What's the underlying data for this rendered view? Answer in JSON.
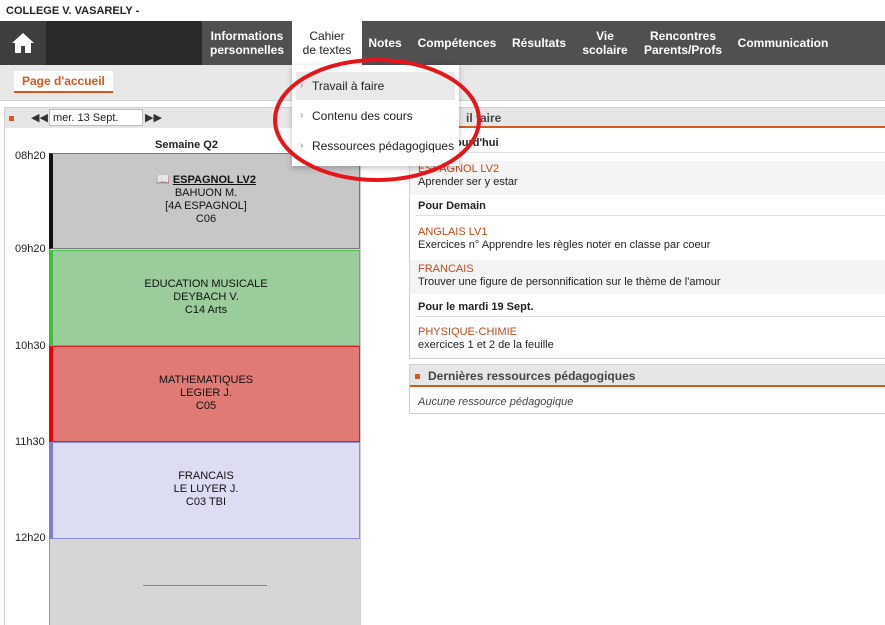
{
  "header": {
    "school_name": "COLLEGE V. VASARELY -"
  },
  "nav": {
    "home_icon": "home-icon",
    "items": [
      {
        "id": "info",
        "line1": "Informations",
        "line2": "personnelles"
      },
      {
        "id": "cahier",
        "line1": "Cahier",
        "line2": "de textes"
      },
      {
        "id": "notes",
        "line1": "Notes",
        "line2": ""
      },
      {
        "id": "competences",
        "line1": "Compétences",
        "line2": ""
      },
      {
        "id": "resultats",
        "line1": "Résultats",
        "line2": ""
      },
      {
        "id": "vie",
        "line1": "Vie",
        "line2": "scolaire"
      },
      {
        "id": "rencontres",
        "line1": "Rencontres",
        "line2": "Parents/Profs"
      },
      {
        "id": "communication",
        "line1": "Communication",
        "line2": ""
      }
    ]
  },
  "subbar": {
    "home_tab": "Page d'accueil"
  },
  "dropdown": {
    "items": [
      {
        "label": "Travail à faire"
      },
      {
        "label": "Contenu des cours"
      },
      {
        "label": "Ressources pédagogiques"
      }
    ]
  },
  "timetable": {
    "date_value": "mer. 13 Sept.",
    "week": "Semaine Q2",
    "times": [
      "08h20",
      "09h20",
      "10h30",
      "11h30",
      "12h20"
    ],
    "courses": [
      {
        "subject": "ESPAGNOL LV2",
        "teacher": "BAHUON M.",
        "group": "[4A ESPAGNOL]",
        "room": "C06",
        "color": "#c7c7c7"
      },
      {
        "subject": "EDUCATION MUSICALE",
        "teacher": "DEYBACH V.",
        "group": "",
        "room": "C14 Arts",
        "color": "#9bcc9b"
      },
      {
        "subject": "MATHEMATIQUES",
        "teacher": "LEGIER J.",
        "group": "",
        "room": "C05",
        "color": "#e07a75"
      },
      {
        "subject": "FRANCAIS",
        "teacher": "LE LUYER J.",
        "group": "",
        "room": "C03 TBI",
        "color": "#dcdcf3"
      }
    ]
  },
  "travail": {
    "title_fragment": "il   faire",
    "today_fragment": "ourd'hui",
    "tasks_today": [
      {
        "subject": "ESPAGNOL LV2",
        "desc": "Aprender ser y estar"
      }
    ],
    "tomorrow_label": "Pour Demain",
    "tasks_tomorrow": [
      {
        "subject": "ANGLAIS LV1",
        "desc": "Exercices n° Apprendre les règles noter en classe par coeur"
      },
      {
        "subject": "FRANCAIS",
        "desc": "Trouver une figure de personnification sur le thème de l'amour"
      }
    ],
    "tuesday_label": "Pour le mardi 19 Sept.",
    "tasks_tuesday": [
      {
        "subject": "PHYSIQUE-CHIMIE",
        "desc": "exercices 1 et 2 de la feuille"
      }
    ]
  },
  "ressources": {
    "title": "Dernières ressources pédagogiques",
    "empty": "Aucune ressource pédagogique"
  },
  "colors": {
    "accent": "#d45a1f",
    "nav_bg": "#505050",
    "annotation": "#e8141c"
  }
}
